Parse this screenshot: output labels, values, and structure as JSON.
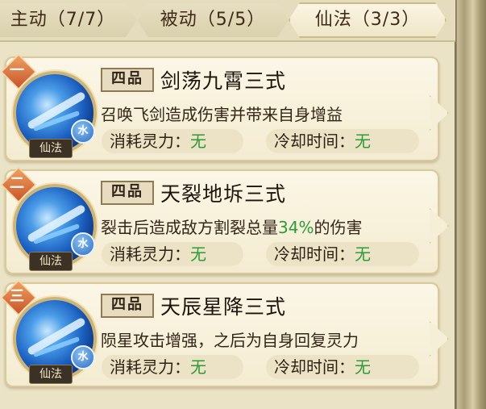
{
  "tabs": [
    {
      "label": "主动（7/7）",
      "active": false
    },
    {
      "label": "被动（5/5）",
      "active": false
    },
    {
      "label": "仙法（3/3）",
      "active": true
    }
  ],
  "skills": [
    {
      "rank": "一",
      "grade": "四品",
      "name": "剑荡九霄三式",
      "desc_before": "召唤飞剑造成伤害并带来自身增益",
      "desc_highlight": "",
      "desc_after": "",
      "element": "水",
      "type": "仙法",
      "cost_label": "消耗灵力：",
      "cost_value": "无",
      "cd_label": "冷却时间：",
      "cd_value": "无"
    },
    {
      "rank": "二",
      "grade": "四品",
      "name": "天裂地坼三式",
      "desc_before": "裂击后造成敌方割裂总量",
      "desc_highlight": "34%",
      "desc_after": "的伤害",
      "element": "水",
      "type": "仙法",
      "cost_label": "消耗灵力：",
      "cost_value": "无",
      "cd_label": "冷却时间：",
      "cd_value": "无"
    },
    {
      "rank": "三",
      "grade": "四品",
      "name": "天辰星降三式",
      "desc_before": "陨星攻击增强，之后为自身回复灵力",
      "desc_highlight": "",
      "desc_after": "",
      "element": "水",
      "type": "仙法",
      "cost_label": "消耗灵力：",
      "cost_value": "无",
      "cd_label": "冷却时间：",
      "cd_value": "无"
    }
  ],
  "colors": {
    "highlight_green": "#2e9a3a",
    "rank_orange": "#d9672f",
    "portrait_blue": "#1b5fc0"
  }
}
